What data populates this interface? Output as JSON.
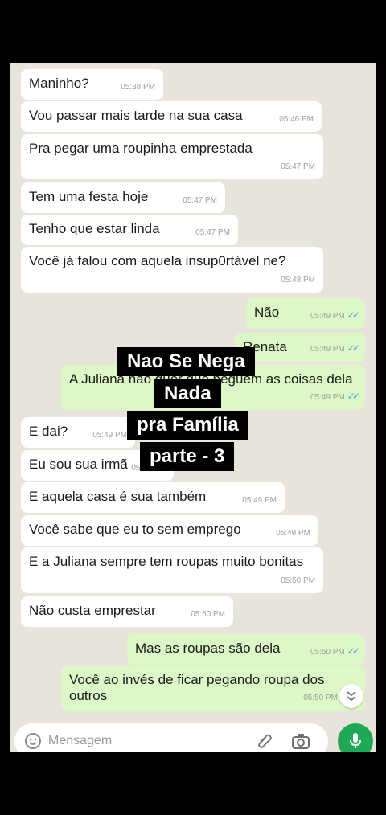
{
  "messages": [
    {
      "text": "Maninho?",
      "time": "05:38 PM"
    },
    {
      "text": "Vou passar mais tarde na sua casa",
      "time": "05:46 PM"
    },
    {
      "text": "Pra pegar uma roupinha emprestada",
      "time": "05:47 PM"
    },
    {
      "text": "Tem uma festa hoje",
      "time": "05:47 PM"
    },
    {
      "text": "Tenho que estar linda",
      "time": "05:47 PM"
    },
    {
      "text": "Você já falou com aquela insup0rtável ne?",
      "time": "05:48 PM"
    },
    {
      "text": "Não",
      "time": "05:49 PM"
    },
    {
      "text": "Renata",
      "time": "05:49 PM"
    },
    {
      "text": "A Juliana não quer que peguem as coisas dela",
      "time": "05:49 PM"
    },
    {
      "text": "E dai?",
      "time": "05:49 PM"
    },
    {
      "text": "Eu sou sua irmã",
      "time": "05:49 PM"
    },
    {
      "text": "E aquela casa é sua também",
      "time": "05:49 PM"
    },
    {
      "text": "Você sabe que eu to sem emprego",
      "time": "05:49 PM"
    },
    {
      "text": "E a Juliana sempre tem roupas muito bonitas",
      "time": "05:50 PM"
    },
    {
      "text": "Não custa emprestar",
      "time": "05:50 PM"
    },
    {
      "text": "Mas as roupas são dela",
      "time": "05:50 PM"
    },
    {
      "text": "Você ao invés de ficar pegando roupa dos outros",
      "time": "05:50 PM"
    }
  ],
  "captions": [
    "Nao Se Nega",
    "Nada",
    "pra Família",
    "parte - 3"
  ],
  "composer": {
    "placeholder": "Mensagem"
  },
  "icons": {
    "read": "double-check-icon",
    "emoji": "emoji-icon",
    "attach": "paperclip-icon",
    "camera": "camera-icon",
    "mic": "mic-icon",
    "scroll": "chevron-down-icon"
  },
  "colors": {
    "incoming": "#ffffff",
    "outgoing": "#dcf8c6",
    "background": "#e8e4dc",
    "ticks": "#4fa6e8",
    "mic": "#1fa855"
  }
}
